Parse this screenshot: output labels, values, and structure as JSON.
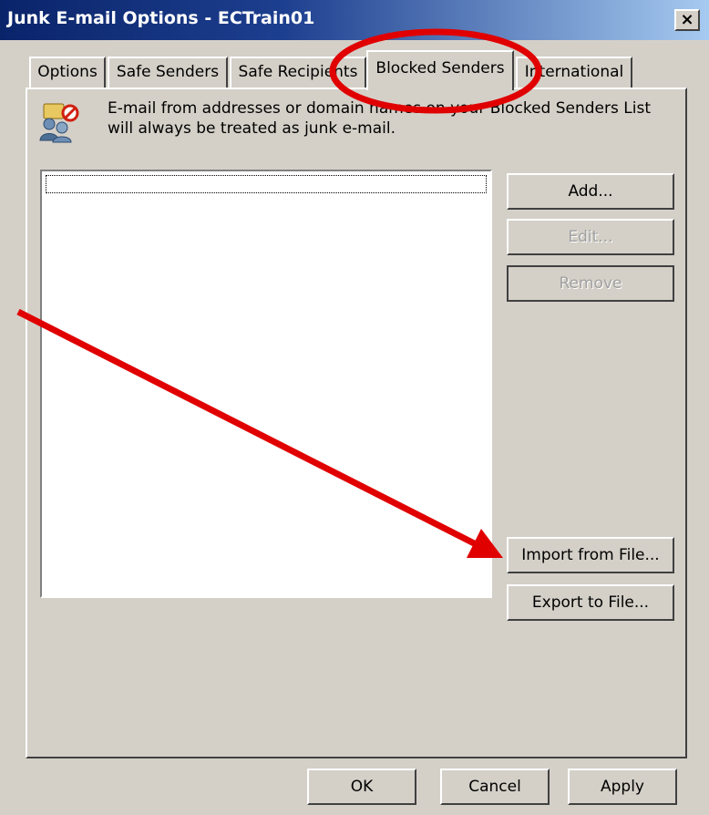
{
  "window": {
    "title": "Junk E-mail Options - ECTrain01",
    "close_label": "×"
  },
  "tabs": [
    {
      "label": "Options",
      "active": false
    },
    {
      "label": "Safe Senders",
      "active": false
    },
    {
      "label": "Safe Recipients",
      "active": false
    },
    {
      "label": "Blocked Senders",
      "active": true
    },
    {
      "label": "International",
      "active": false
    }
  ],
  "info": {
    "icon": "blocked-senders-icon",
    "text": "E-mail from addresses or domain names on your Blocked Senders List will always be treated as junk e-mail."
  },
  "blocked_list": {
    "items": []
  },
  "side_buttons": {
    "add": "Add...",
    "edit": "Edit...",
    "remove": "Remove",
    "import": "Import from File...",
    "export": "Export to File..."
  },
  "bottom_buttons": {
    "ok": "OK",
    "cancel": "Cancel",
    "apply": "Apply"
  },
  "annotations": {
    "highlight_color": "#e00000"
  }
}
